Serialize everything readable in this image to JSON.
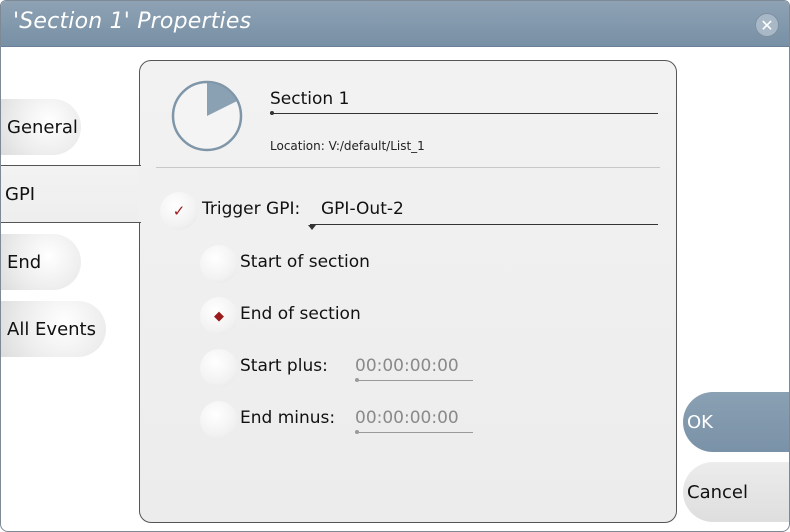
{
  "window": {
    "title": "'Section 1' Properties",
    "close_icon": "close-icon"
  },
  "tabs": [
    {
      "label": "General",
      "active": false
    },
    {
      "label": "GPI",
      "active": true
    },
    {
      "label": "End",
      "active": false
    },
    {
      "label": "All Events",
      "active": false
    }
  ],
  "section": {
    "name": "Section 1",
    "location": "Location: V:/default/List_1",
    "icon": "pie-clock-icon"
  },
  "gpi": {
    "trigger_label": "Trigger GPI:",
    "trigger_value": "GPI-Out-2",
    "trigger_checked": true,
    "options": [
      {
        "label": "Start of section",
        "selected": false
      },
      {
        "label": "End of section",
        "selected": true
      },
      {
        "label": "Start plus:",
        "selected": false,
        "timecode": "00:00:00:00"
      },
      {
        "label": "End minus:",
        "selected": false,
        "timecode": "00:00:00:00"
      }
    ]
  },
  "buttons": {
    "ok": "OK",
    "cancel": "Cancel"
  },
  "colors": {
    "accent": "#7a92a7",
    "check": "#9a1c1c",
    "titlebar": "#8296aa"
  }
}
